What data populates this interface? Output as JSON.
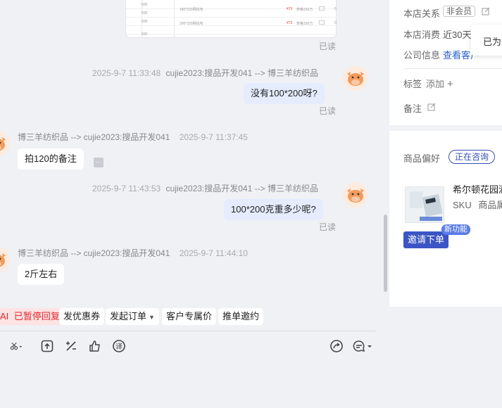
{
  "image_card": {
    "rows": [
      {
        "qty": "600",
        "spec": "",
        "price": "",
        "note": ""
      },
      {
        "qty": "600",
        "spec": "",
        "price": "",
        "note": ""
      },
      {
        "qty": "600",
        "spec": "180*220网纹布",
        "price": "¥73",
        "note": "表格150万"
      },
      {
        "qty": "600",
        "spec": "",
        "price": "",
        "note": ""
      },
      {
        "qty": "600",
        "spec": "200*220网纹布",
        "price": "¥73",
        "note": "表格150万"
      },
      {
        "qty": "600",
        "spec": "",
        "price": "",
        "note": ""
      }
    ],
    "right_digit": "0"
  },
  "messages": [
    {
      "direction": "out",
      "meta_time": "2025-9-7 11:33:48",
      "meta_route": "cujie2023:搜品开发041 --> 博三羊纺织品",
      "text": "没有100*200呀?",
      "status": "已读"
    },
    {
      "direction": "in",
      "meta_route": "博三羊纺织品 --> cujie2023:搜品开发041",
      "meta_time": "2025-9-7 11:37:45",
      "text": "拍120的备注"
    },
    {
      "direction": "out",
      "meta_time": "2025-9-7 11:43:53",
      "meta_route": "cujie2023:搜品开发041 --> 博三羊纺织品",
      "text": "100*200克重多少呢?",
      "status": "已读"
    },
    {
      "direction": "in",
      "meta_route": "博三羊纺织品 --> cujie2023:搜品开发041",
      "meta_time": "2025-9-7 11:44:10",
      "text": "2斤左右"
    }
  ],
  "first_status": "已读",
  "quick_actions": {
    "ai_prefix": "AI",
    "ai_paused": "已暂停回复",
    "coupon": "发优惠券",
    "create_order": "发起订单",
    "exclusive_price": "客户专属价",
    "recommend_invite": "推单邀约"
  },
  "right_panel": {
    "store_relation_label": "本店关系",
    "store_relation_value": "非会员",
    "store_spend_label": "本店消费",
    "store_spend_value": "近30天",
    "company_label": "公司信息",
    "company_link": "查看客户",
    "popup_text": "已为您",
    "tags_label": "标签",
    "tags_add": "添加",
    "remark_label": "备注",
    "product_pref_label": "商品偏好",
    "consulting_pill": "正在咨询",
    "product_title": "希尔顿花园酒",
    "sku_label": "SKU",
    "product_attr": "商品属性",
    "invite_order": "邀请下单",
    "new_feature": "新功能"
  },
  "colors": {
    "accent": "#3b55c4",
    "out_bubble": "#e4ecfe",
    "ai_paused": "#e0292d"
  }
}
